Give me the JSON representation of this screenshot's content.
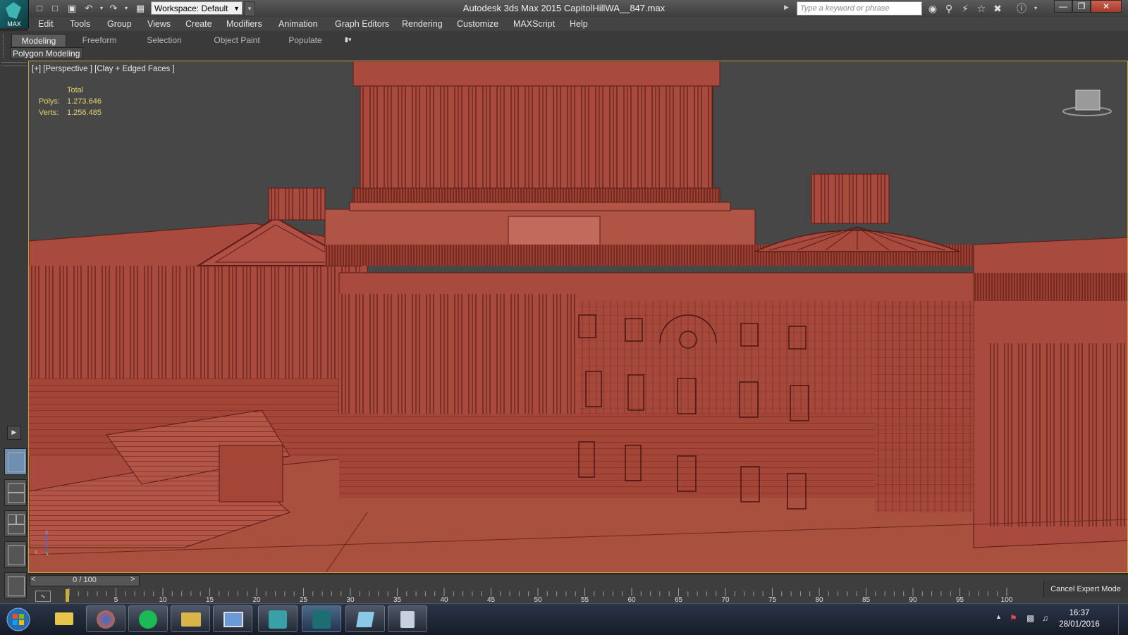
{
  "app": {
    "logo_label": "MAX",
    "window_title": "Autodesk 3ds Max  2015     CapitolHillWA__847.max",
    "workspace": "Workspace: Default",
    "search_placeholder": "Type a keyword or phrase"
  },
  "menu": [
    "Edit",
    "Tools",
    "Group",
    "Views",
    "Create",
    "Modifiers",
    "Animation",
    "Graph Editors",
    "Rendering",
    "Customize",
    "MAXScript",
    "Help"
  ],
  "ribbon": {
    "tabs": [
      "Modeling",
      "Freeform",
      "Selection",
      "Object Paint",
      "Populate"
    ],
    "active_tab": "Modeling",
    "panel_label": "Polygon Modeling"
  },
  "viewport": {
    "label": "[+] [Perspective ] [Clay + Edged Faces ]",
    "stats_header": "Total",
    "polys_label": "Polys:",
    "polys_value": "1.273.646",
    "verts_label": "Verts:",
    "verts_value": "1.256.485",
    "axis_z": "z",
    "axis_x": "x"
  },
  "timeline": {
    "slider_text": "0 / 100",
    "prev": "<",
    "next": ">",
    "ticks": [
      "5",
      "10",
      "15",
      "20",
      "25",
      "30",
      "35",
      "40",
      "45",
      "50",
      "55",
      "60",
      "65",
      "70",
      "75",
      "80",
      "85",
      "90",
      "95",
      "100"
    ],
    "expert_mode": "Cancel Expert Mode"
  },
  "taskbar": {
    "time": "16:37",
    "date": "28/01/2016"
  },
  "colors": {
    "model": "#a84a3e",
    "model_dark": "#5a1c16",
    "viewport_bg": "#474747",
    "accent": "#c9a23a"
  }
}
